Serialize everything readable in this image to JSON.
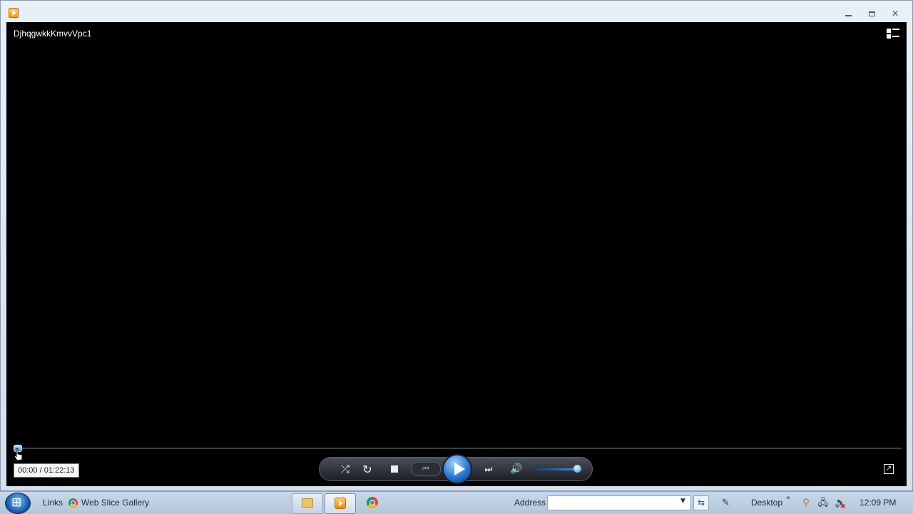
{
  "window": {
    "app_icon": "windows-media-player-icon",
    "controls": {
      "minimize": "minimize-icon",
      "maximize": "maximize-icon",
      "close": "close-icon"
    }
  },
  "player": {
    "media_title": "DjhqgwkkKmvvVpc1",
    "time_display": "00:00 / 01:22:13",
    "seek_position": 0.0,
    "volume_level": 0.95,
    "controls": {
      "shuffle": "shuffle-icon",
      "repeat": "repeat-icon",
      "stop": "stop-icon",
      "previous": "previous-icon",
      "play": "play-icon",
      "next": "next-icon",
      "mute": "volume-icon",
      "switch_to_library": "switch-to-library-icon",
      "fullscreen": "fullscreen-icon"
    },
    "accent_color": "#3f94e0"
  },
  "taskbar": {
    "links_label": "Links",
    "web_slice_label": "Web Slice Gallery",
    "address_label": "Address",
    "address_value": "",
    "desktop_label": "Desktop",
    "clock": "12:09 PM",
    "pinned_apps": [
      "windows-explorer-icon",
      "windows-media-player-icon",
      "chrome-icon"
    ]
  }
}
